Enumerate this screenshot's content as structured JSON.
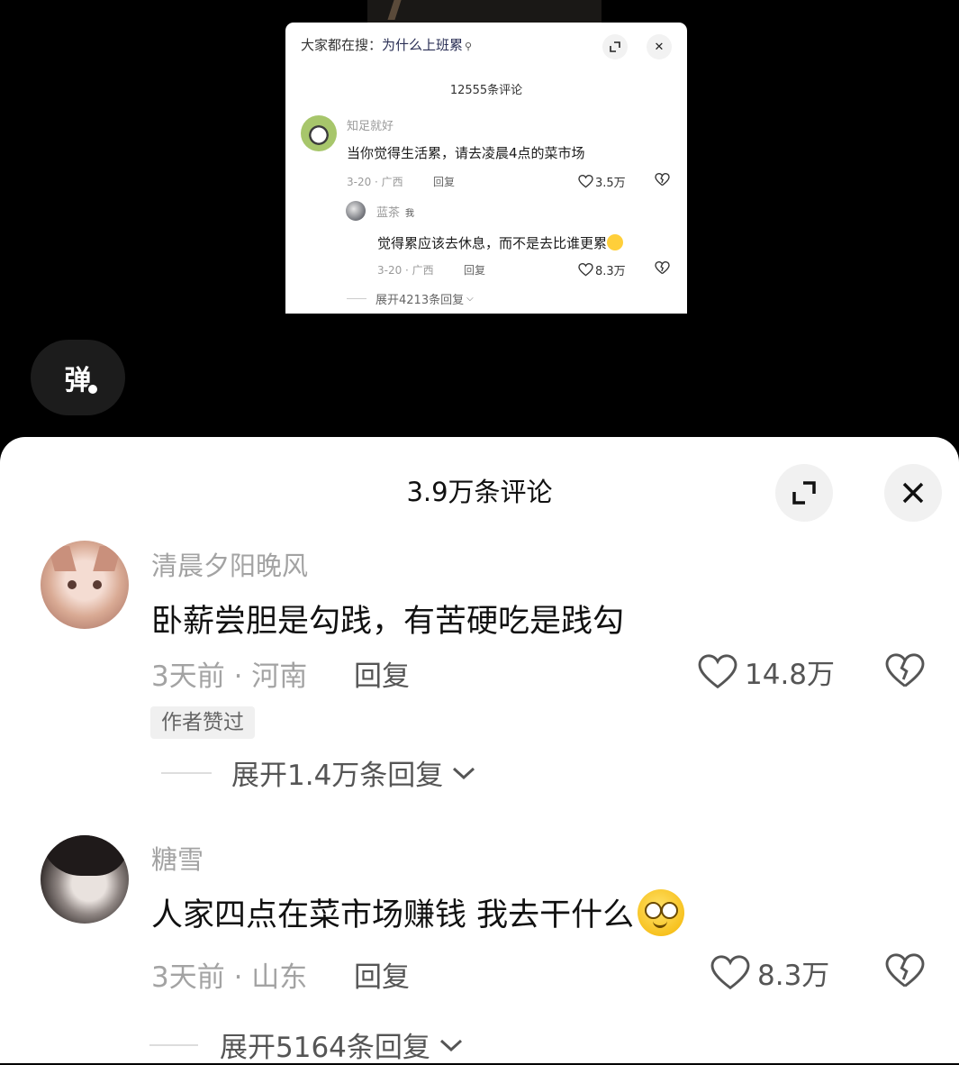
{
  "mini_panel": {
    "search_prefix": "大家都在搜：",
    "search_keyword": "为什么上班累",
    "search_icon": "search-icon",
    "title": "12555条评论",
    "comment": {
      "user": "知足就好",
      "text": "当你觉得生活累，请去凌晨4点的菜市场",
      "meta": "3-20 · 广西",
      "reply": "回复",
      "likes": "3.5万"
    },
    "sub_comment": {
      "user": "蓝茶",
      "me_tag": "我",
      "text": "觉得累应该去休息，而不是去比谁更累",
      "meta": "3-20 · 广西",
      "reply": "回复",
      "likes": "8.3万"
    },
    "expand": "展开4213条回复"
  },
  "danmu_button": {
    "label": "弹"
  },
  "sheet": {
    "title": "3.9万条评论",
    "comments": [
      {
        "user": "清晨夕阳晚风",
        "text": "卧薪尝胆是勾践，有苦硬吃是践勾",
        "meta": "3天前 · 河南",
        "reply": "回复",
        "likes": "14.8万",
        "tag": "作者赞过",
        "expand": "展开1.4万条回复"
      },
      {
        "user": "糖雪",
        "text": "人家四点在菜市场赚钱 我去干什么",
        "meta": "3天前 · 山东",
        "reply": "回复",
        "likes": "8.3万",
        "expand": "展开5164条回复"
      }
    ]
  },
  "colors": {
    "sheet_bg": "#ffffff",
    "page_bg": "#000000",
    "muted": "#a3a3a3"
  }
}
